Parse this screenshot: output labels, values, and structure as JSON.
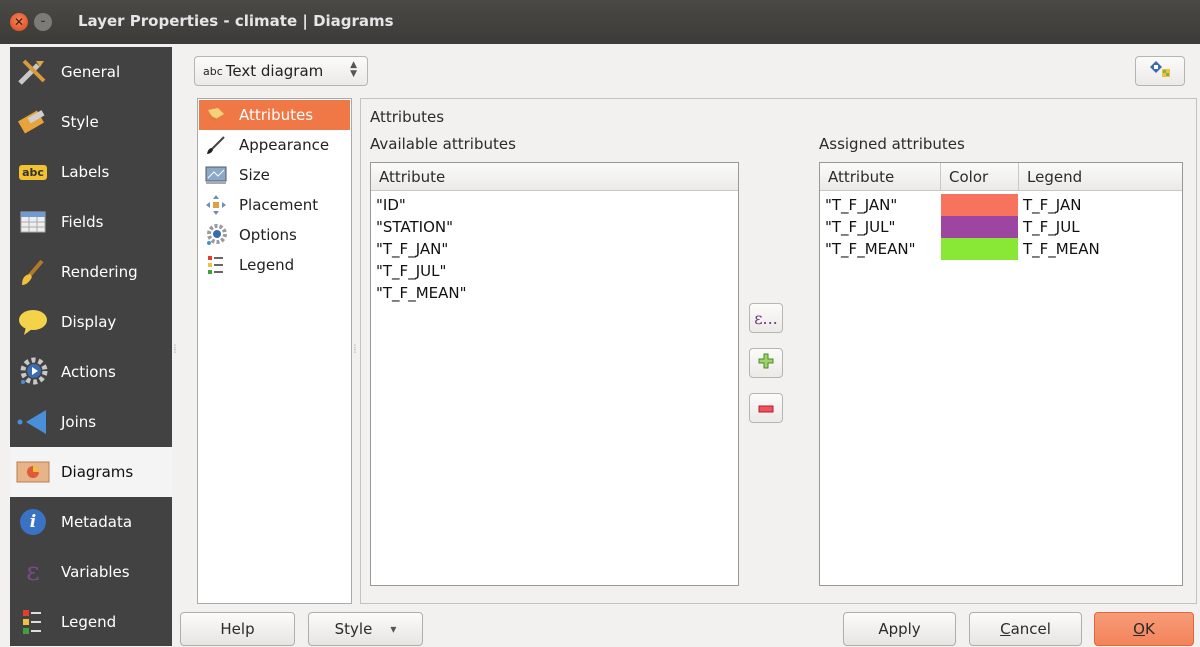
{
  "window": {
    "title": "Layer Properties - climate | Diagrams",
    "close_glyph": "✕",
    "min_glyph": "–"
  },
  "sidebar": {
    "items": [
      {
        "label": "General",
        "icon": "general-tools-icon"
      },
      {
        "label": "Style",
        "icon": "style-brush-icon"
      },
      {
        "label": "Labels",
        "icon": "labels-abc-icon",
        "icon_text": "abc"
      },
      {
        "label": "Fields",
        "icon": "fields-table-icon"
      },
      {
        "label": "Rendering",
        "icon": "rendering-brush-icon"
      },
      {
        "label": "Display",
        "icon": "display-bubble-icon"
      },
      {
        "label": "Actions",
        "icon": "actions-gear-icon"
      },
      {
        "label": "Joins",
        "icon": "joins-arrow-icon"
      },
      {
        "label": "Diagrams",
        "icon": "diagrams-icon",
        "selected": true
      },
      {
        "label": "Metadata",
        "icon": "metadata-info-icon",
        "icon_text": "i"
      },
      {
        "label": "Variables",
        "icon": "variables-epsilon-icon",
        "icon_text": "ε"
      },
      {
        "label": "Legend",
        "icon": "legend-icon"
      }
    ]
  },
  "toolbar": {
    "diagram_type_prefix": "abc",
    "diagram_type": "Text diagram",
    "spin_up": "▲",
    "spin_down": "▼"
  },
  "subnav": {
    "items": [
      {
        "label": "Attributes",
        "icon": "attributes-icon",
        "selected": true
      },
      {
        "label": "Appearance",
        "icon": "appearance-brush-icon"
      },
      {
        "label": "Size",
        "icon": "size-icon"
      },
      {
        "label": "Placement",
        "icon": "placement-icon"
      },
      {
        "label": "Options",
        "icon": "options-gear-icon"
      },
      {
        "label": "Legend",
        "icon": "legend-icon"
      }
    ]
  },
  "attributes": {
    "section_title": "Attributes",
    "available_title": "Available attributes",
    "available_header": "Attribute",
    "available": [
      "\"ID\"",
      "\"STATION\"",
      "\"T_F_JAN\"",
      "\"T_F_JUL\"",
      "\"T_F_MEAN\""
    ],
    "assigned_title": "Assigned attributes",
    "assigned_headers": {
      "attribute": "Attribute",
      "color": "Color",
      "legend": "Legend"
    },
    "assigned": [
      {
        "attribute": "\"T_F_JAN\"",
        "color": "#f7735e",
        "legend": "T_F_JAN"
      },
      {
        "attribute": "\"T_F_JUL\"",
        "color": "#9c45a1",
        "legend": "T_F_JUL"
      },
      {
        "attribute": "\"T_F_MEAN\"",
        "color": "#88e835",
        "legend": "T_F_MEAN"
      }
    ]
  },
  "mid_buttons": {
    "expression": "ε...",
    "add": "add-icon",
    "remove": "remove-icon"
  },
  "footer": {
    "help": "Help",
    "style": "Style",
    "style_arrow": "▾",
    "apply": "Apply",
    "cancel_first": "C",
    "cancel_rest": "ancel",
    "ok_first": "O",
    "ok_rest": "K"
  }
}
